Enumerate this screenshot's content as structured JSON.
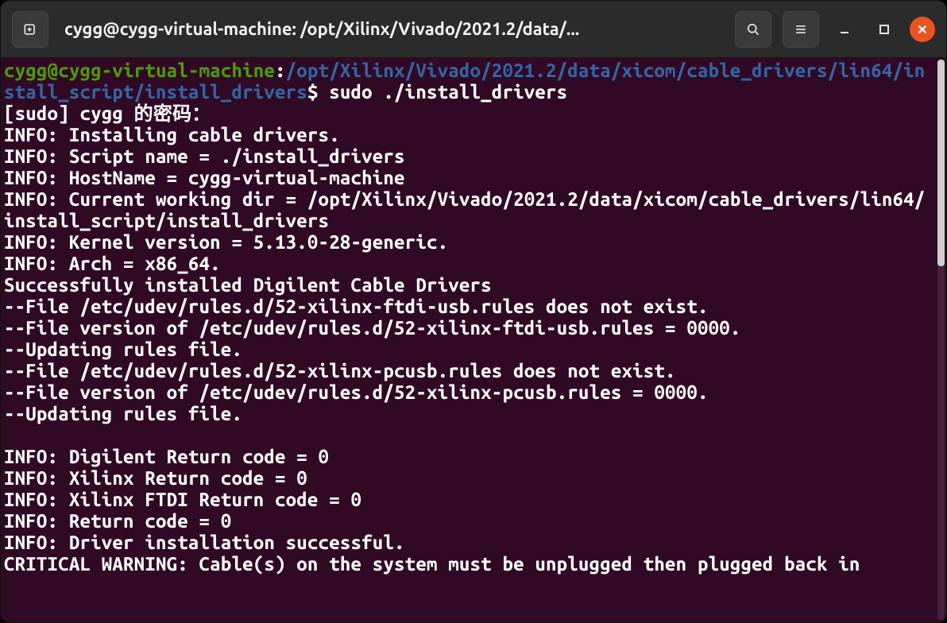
{
  "titlebar": {
    "title": "cygg@cygg-virtual-machine: /opt/Xilinx/Vivado/2021.2/data/..."
  },
  "prompt": {
    "user": "cygg@cygg-virtual-machine",
    "colon": ":",
    "path": "/opt/Xilinx/Vivado/2021.2/data/xicom/cable_drivers/lin64/install_script/install_drivers",
    "dollar": "$ ",
    "command": "sudo ./install_drivers"
  },
  "output": [
    "[sudo] cygg 的密码：",
    "INFO: Installing cable drivers.",
    "INFO: Script name = ./install_drivers",
    "INFO: HostName = cygg-virtual-machine",
    "INFO: Current working dir = /opt/Xilinx/Vivado/2021.2/data/xicom/cable_drivers/lin64/install_script/install_drivers",
    "INFO: Kernel version = 5.13.0-28-generic.",
    "INFO: Arch = x86_64.",
    "Successfully installed Digilent Cable Drivers",
    "--File /etc/udev/rules.d/52-xilinx-ftdi-usb.rules does not exist.",
    "--File version of /etc/udev/rules.d/52-xilinx-ftdi-usb.rules = 0000.",
    "--Updating rules file.",
    "--File /etc/udev/rules.d/52-xilinx-pcusb.rules does not exist.",
    "--File version of /etc/udev/rules.d/52-xilinx-pcusb.rules = 0000.",
    "--Updating rules file.",
    "",
    "INFO: Digilent Return code = 0",
    "INFO: Xilinx Return code = 0",
    "INFO: Xilinx FTDI Return code = 0",
    "INFO: Return code = 0",
    "INFO: Driver installation successful.",
    "CRITICAL WARNING: Cable(s) on the system must be unplugged then plugged back in"
  ],
  "colors": {
    "bg": "#300a24",
    "titlebar": "#2b2b2b",
    "close": "#e95420",
    "user": "#4e9a06",
    "path": "#3465a4"
  }
}
